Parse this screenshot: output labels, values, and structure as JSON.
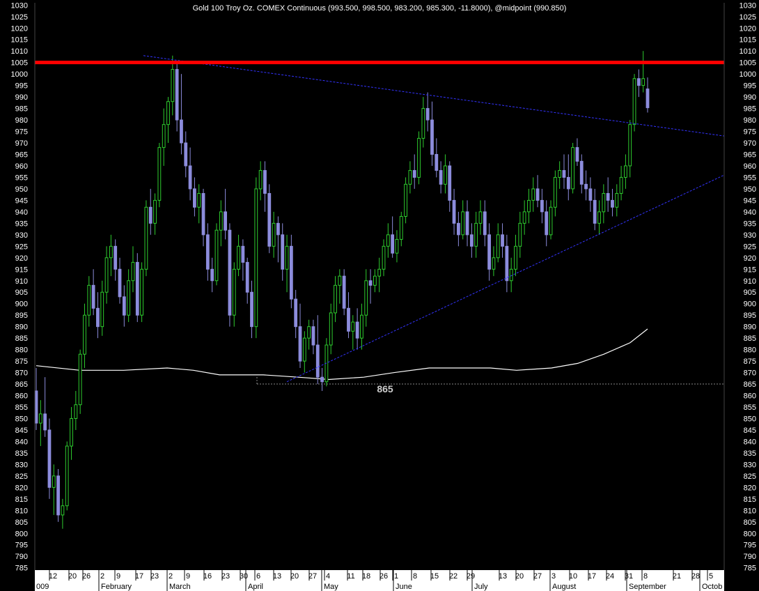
{
  "chart_data": {
    "type": "candlestick",
    "title": "Gold 100 Troy Oz. COMEX Continuous (993.500, 998.500, 983.200, 985.300, -11.8000), @midpoint (990.850)",
    "ylim": [
      785,
      1030
    ],
    "y_ticks": [
      785,
      790,
      795,
      800,
      805,
      810,
      815,
      820,
      825,
      830,
      835,
      840,
      845,
      850,
      855,
      860,
      865,
      870,
      875,
      880,
      885,
      890,
      895,
      900,
      905,
      910,
      915,
      920,
      925,
      930,
      935,
      940,
      945,
      950,
      955,
      960,
      965,
      970,
      975,
      980,
      985,
      990,
      995,
      1000,
      1005,
      1010,
      1015,
      1020,
      1025,
      1030
    ],
    "x_day_ticks": [
      "12",
      "20",
      "26",
      "2",
      "9",
      "17",
      "23",
      "2",
      "9",
      "16",
      "23",
      "30",
      "6",
      "13",
      "20",
      "27",
      "4",
      "11",
      "18",
      "26",
      "1",
      "8",
      "15",
      "22",
      "29",
      "13",
      "20",
      "27",
      "3",
      "10",
      "17",
      "24",
      "31",
      "8",
      "21",
      "28",
      "5"
    ],
    "x_month_labels": [
      "009",
      "February",
      "March",
      "April",
      "May",
      "June",
      "July",
      "August",
      "September",
      "Octob"
    ],
    "annotation": "865",
    "resistance_level": 1005,
    "support_level": 865,
    "colors": {
      "up": "#2ecc2e",
      "down": "#8c8cdc",
      "resistance": "#ff0000",
      "trendline": "#3333ff",
      "moving_average": "#ffffff",
      "axis_text": "#ffffff"
    },
    "candles": [
      [
        862,
        872,
        845,
        848
      ],
      [
        848,
        858,
        838,
        852
      ],
      [
        852,
        868,
        842,
        845
      ],
      [
        845,
        850,
        815,
        820
      ],
      [
        820,
        830,
        808,
        825
      ],
      [
        825,
        828,
        805,
        808
      ],
      [
        808,
        815,
        802,
        812
      ],
      [
        812,
        840,
        810,
        838
      ],
      [
        838,
        855,
        832,
        850
      ],
      [
        850,
        862,
        845,
        856
      ],
      [
        856,
        880,
        852,
        878
      ],
      [
        878,
        900,
        872,
        895
      ],
      [
        895,
        912,
        890,
        908
      ],
      [
        908,
        915,
        895,
        898
      ],
      [
        898,
        905,
        885,
        890
      ],
      [
        890,
        910,
        886,
        905
      ],
      [
        905,
        925,
        900,
        920
      ],
      [
        920,
        930,
        912,
        925
      ],
      [
        925,
        928,
        910,
        915
      ],
      [
        915,
        920,
        900,
        903
      ],
      [
        903,
        908,
        890,
        895
      ],
      [
        895,
        915,
        892,
        910
      ],
      [
        910,
        925,
        905,
        918
      ],
      [
        918,
        922,
        892,
        895
      ],
      [
        895,
        918,
        892,
        915
      ],
      [
        915,
        945,
        912,
        942
      ],
      [
        942,
        950,
        930,
        935
      ],
      [
        935,
        948,
        930,
        945
      ],
      [
        945,
        970,
        942,
        968
      ],
      [
        968,
        985,
        960,
        978
      ],
      [
        978,
        990,
        970,
        988
      ],
      [
        988,
        1008,
        982,
        1002
      ],
      [
        1002,
        1005,
        975,
        980
      ],
      [
        980,
        1000,
        965,
        970
      ],
      [
        970,
        975,
        955,
        960
      ],
      [
        960,
        968,
        945,
        950
      ],
      [
        950,
        955,
        938,
        942
      ],
      [
        942,
        952,
        935,
        948
      ],
      [
        948,
        950,
        925,
        930
      ],
      [
        930,
        935,
        910,
        915
      ],
      [
        915,
        920,
        905,
        910
      ],
      [
        910,
        935,
        908,
        932
      ],
      [
        932,
        945,
        925,
        940
      ],
      [
        940,
        950,
        928,
        932
      ],
      [
        932,
        935,
        890,
        895
      ],
      [
        895,
        918,
        890,
        915
      ],
      [
        915,
        930,
        912,
        925
      ],
      [
        925,
        928,
        910,
        918
      ],
      [
        918,
        920,
        900,
        905
      ],
      [
        905,
        910,
        885,
        890
      ],
      [
        890,
        955,
        885,
        950
      ],
      [
        950,
        962,
        945,
        958
      ],
      [
        958,
        962,
        940,
        948
      ],
      [
        948,
        952,
        922,
        925
      ],
      [
        925,
        940,
        920,
        935
      ],
      [
        935,
        938,
        918,
        930
      ],
      [
        930,
        935,
        910,
        915
      ],
      [
        915,
        930,
        905,
        925
      ],
      [
        925,
        930,
        898,
        902
      ],
      [
        902,
        906,
        885,
        890
      ],
      [
        890,
        900,
        872,
        875
      ],
      [
        875,
        888,
        870,
        885
      ],
      [
        885,
        893,
        880,
        890
      ],
      [
        890,
        893,
        878,
        882
      ],
      [
        882,
        895,
        865,
        868
      ],
      [
        868,
        872,
        862,
        866
      ],
      [
        866,
        885,
        864,
        882
      ],
      [
        882,
        900,
        878,
        896
      ],
      [
        896,
        912,
        892,
        908
      ],
      [
        908,
        915,
        900,
        912
      ],
      [
        912,
        915,
        895,
        898
      ],
      [
        898,
        905,
        885,
        888
      ],
      [
        888,
        895,
        880,
        892
      ],
      [
        892,
        898,
        880,
        885
      ],
      [
        885,
        900,
        880,
        895
      ],
      [
        895,
        915,
        890,
        910
      ],
      [
        910,
        915,
        900,
        908
      ],
      [
        908,
        915,
        905,
        912
      ],
      [
        912,
        920,
        905,
        915
      ],
      [
        915,
        928,
        912,
        925
      ],
      [
        925,
        935,
        920,
        930
      ],
      [
        930,
        938,
        920,
        922
      ],
      [
        922,
        932,
        918,
        928
      ],
      [
        928,
        940,
        925,
        938
      ],
      [
        938,
        955,
        935,
        952
      ],
      [
        952,
        962,
        948,
        958
      ],
      [
        958,
        965,
        950,
        955
      ],
      [
        955,
        975,
        952,
        972
      ],
      [
        972,
        990,
        968,
        985
      ],
      [
        985,
        992,
        975,
        980
      ],
      [
        980,
        988,
        960,
        965
      ],
      [
        965,
        972,
        955,
        958
      ],
      [
        958,
        962,
        948,
        952
      ],
      [
        952,
        965,
        948,
        960
      ],
      [
        960,
        962,
        940,
        945
      ],
      [
        945,
        950,
        930,
        935
      ],
      [
        935,
        940,
        925,
        930
      ],
      [
        930,
        945,
        928,
        940
      ],
      [
        940,
        945,
        925,
        930
      ],
      [
        930,
        935,
        920,
        925
      ],
      [
        925,
        940,
        920,
        935
      ],
      [
        935,
        945,
        930,
        940
      ],
      [
        940,
        945,
        925,
        930
      ],
      [
        930,
        935,
        910,
        915
      ],
      [
        915,
        925,
        912,
        920
      ],
      [
        920,
        935,
        918,
        930
      ],
      [
        930,
        935,
        920,
        925
      ],
      [
        925,
        930,
        905,
        910
      ],
      [
        910,
        920,
        905,
        915
      ],
      [
        915,
        930,
        912,
        925
      ],
      [
        925,
        940,
        920,
        935
      ],
      [
        935,
        945,
        930,
        940
      ],
      [
        940,
        950,
        935,
        945
      ],
      [
        945,
        955,
        940,
        950
      ],
      [
        950,
        956,
        942,
        945
      ],
      [
        945,
        950,
        935,
        940
      ],
      [
        940,
        945,
        925,
        930
      ],
      [
        930,
        945,
        928,
        942
      ],
      [
        942,
        958,
        938,
        955
      ],
      [
        955,
        962,
        950,
        958
      ],
      [
        958,
        965,
        950,
        955
      ],
      [
        955,
        965,
        945,
        950
      ],
      [
        950,
        970,
        948,
        968
      ],
      [
        968,
        972,
        960,
        962
      ],
      [
        962,
        965,
        948,
        952
      ],
      [
        952,
        958,
        945,
        950
      ],
      [
        950,
        955,
        940,
        945
      ],
      [
        945,
        950,
        932,
        935
      ],
      [
        935,
        945,
        930,
        940
      ],
      [
        940,
        952,
        935,
        948
      ],
      [
        948,
        955,
        940,
        945
      ],
      [
        945,
        950,
        938,
        942
      ],
      [
        942,
        952,
        938,
        948
      ],
      [
        948,
        960,
        945,
        955
      ],
      [
        955,
        965,
        950,
        960
      ],
      [
        960,
        980,
        955,
        978
      ],
      [
        978,
        1000,
        975,
        998
      ],
      [
        998,
        1002,
        990,
        995
      ],
      [
        995,
        1010,
        992,
        998
      ],
      [
        993.5,
        998.5,
        983.2,
        985.3
      ]
    ],
    "trendlines": [
      {
        "from": [
          17,
          1008
        ],
        "to": [
          140,
          973
        ]
      },
      {
        "from": [
          67,
          866
        ],
        "to": [
          140,
          956
        ]
      }
    ],
    "moving_average": [
      [
        0,
        873
      ],
      [
        10,
        871
      ],
      [
        20,
        871
      ],
      [
        30,
        872
      ],
      [
        36,
        871
      ],
      [
        42,
        869
      ],
      [
        52,
        869
      ],
      [
        60,
        868
      ],
      [
        67,
        867
      ],
      [
        75,
        868
      ],
      [
        82,
        870
      ],
      [
        90,
        872
      ],
      [
        96,
        872
      ],
      [
        104,
        872
      ],
      [
        110,
        871
      ],
      [
        118,
        872
      ],
      [
        124,
        874
      ],
      [
        130,
        878
      ],
      [
        136,
        883
      ],
      [
        140,
        889
      ]
    ]
  }
}
